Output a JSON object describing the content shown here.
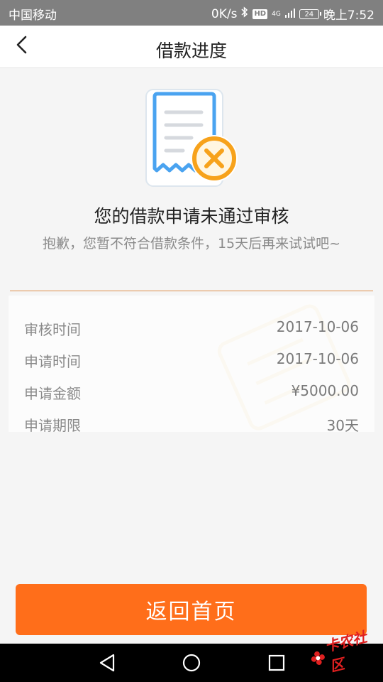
{
  "status_bar": {
    "carrier": "中国移动",
    "speed": "0K/s",
    "hd": "HD",
    "net": "4G",
    "battery": "24",
    "time": "晚上7:52"
  },
  "header": {
    "title": "借款进度"
  },
  "result": {
    "title": "您的借款申请未通过审核",
    "description": "抱歉，您暂不符合借款条件，15天后再来试试吧~"
  },
  "details": [
    {
      "label": "审核时间",
      "value": "2017-10-06"
    },
    {
      "label": "申请时间",
      "value": "2017-10-06"
    },
    {
      "label": "申请金额",
      "value": "¥5000.00"
    },
    {
      "label": "申请期限",
      "value": "30天"
    }
  ],
  "footer": {
    "button_label": "返回首页"
  },
  "watermark_logo": {
    "text": "卡农社区"
  },
  "colors": {
    "accent": "#ff6e1a",
    "icon_blue": "#4aa3f0",
    "icon_orange": "#f7a21b",
    "divider": "#e0904c"
  }
}
